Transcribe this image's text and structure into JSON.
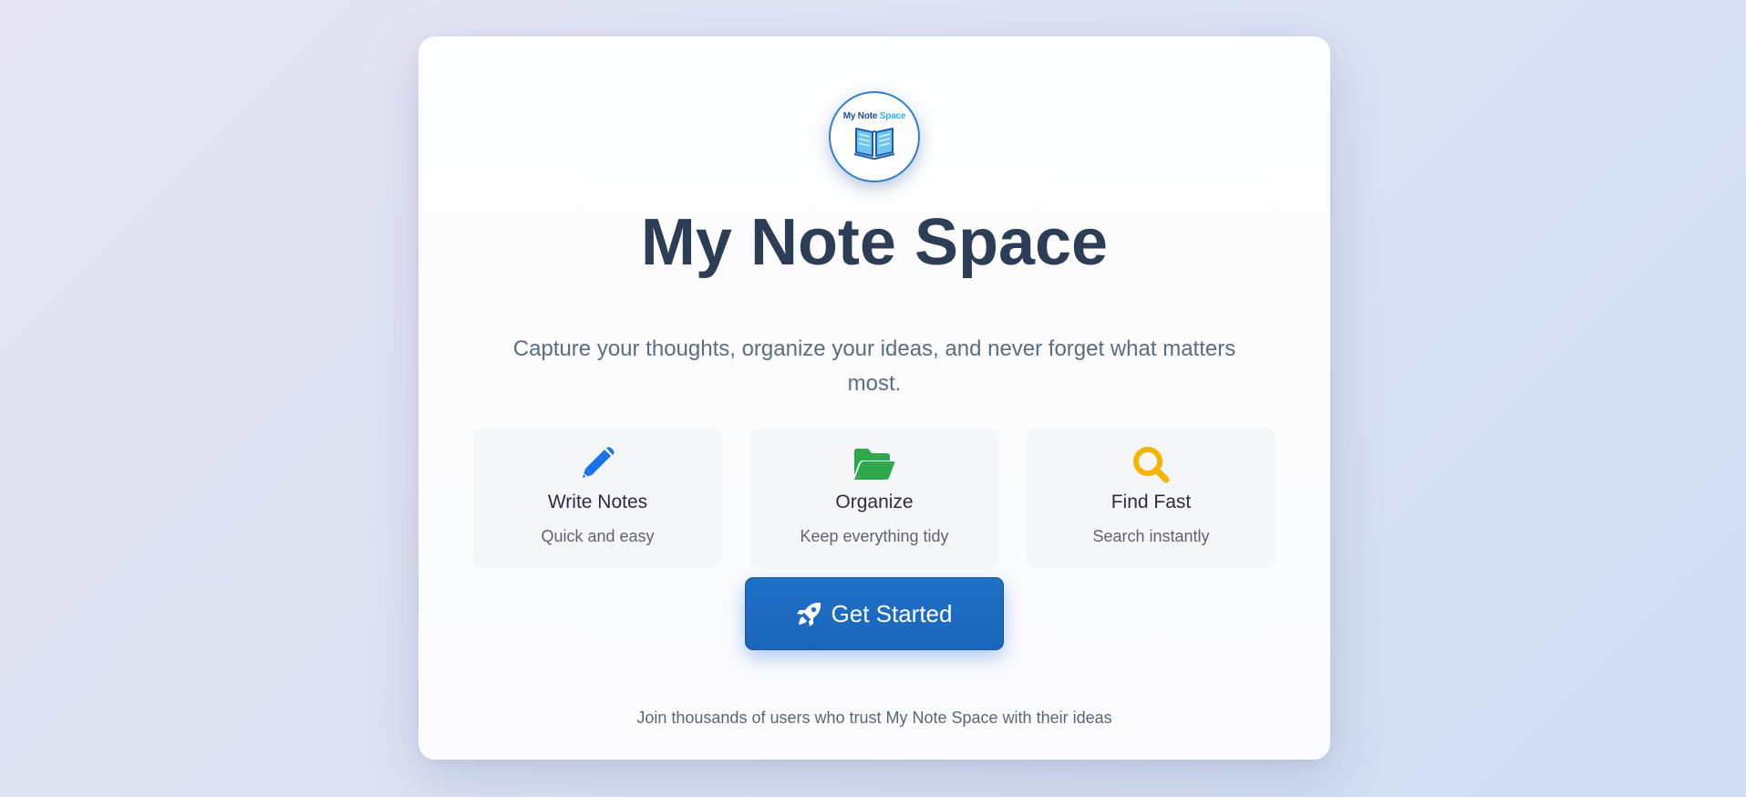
{
  "logo": {
    "text_part1": "My N",
    "text_part2": "ote ",
    "text_part3": "Space",
    "icon": "open-book-icon"
  },
  "hero": {
    "title": "My Note Space",
    "subtitle": "Capture your thoughts, organize your ideas, and never forget what matters most."
  },
  "features": [
    {
      "icon": "pencil-icon",
      "color": "#1a73e8",
      "title": "Write Notes",
      "description": "Quick and easy"
    },
    {
      "icon": "folder-open-icon",
      "color": "#2ea84a",
      "title": "Organize",
      "description": "Keep everything tidy"
    },
    {
      "icon": "magnifier-icon",
      "color": "#f5b400",
      "title": "Find Fast",
      "description": "Search instantly"
    }
  ],
  "cta": {
    "icon": "rocket-icon",
    "label": "Get Started"
  },
  "footer": {
    "note": "Join thousands of users who trust My Note Space with their ideas"
  },
  "colors": {
    "title": "#2c3e55",
    "subtitle": "#5a6d84",
    "cta_background": "#1e70c7",
    "logo_border": "#2f7fd1"
  }
}
